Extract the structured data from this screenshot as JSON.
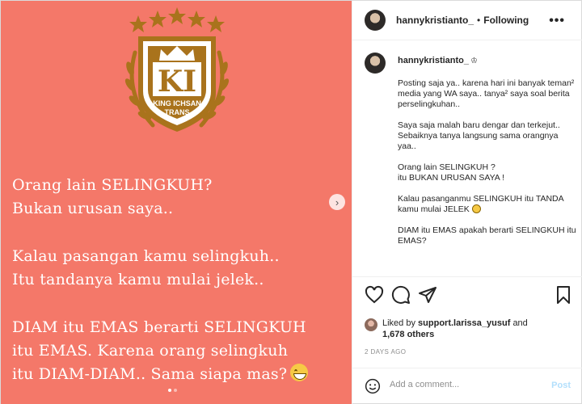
{
  "post": {
    "username": "hannykristianto_",
    "separator": "•",
    "follow_status": "Following",
    "more_icon": "more-icon",
    "colors": {
      "slide_bg": "#f47869",
      "logo_gold": "#a9731c",
      "link": "#0095f6"
    }
  },
  "slide": {
    "logo_text_line1": "KING ICHSAN",
    "logo_text_line2": "TRANS",
    "logo_monogram": "KI",
    "paragraph1": "Orang lain SELINGKUH?\nBukan urusan saya..",
    "paragraph2": "Kalau pasangan kamu selingkuh..\nItu tandanya kamu mulai jelek..",
    "paragraph3_line1": "DIAM itu EMAS berarti SELINGKUH",
    "paragraph3_line2": "itu EMAS. Karena orang selingkuh",
    "paragraph3_line3": "itu DIAM-DIAM.. Sama siapa mas?",
    "next_icon": "›"
  },
  "caption": {
    "username": "hannykristianto_",
    "badge": "♔",
    "text_part1": "Posting saja ya.. karena hari ini banyak teman² media yang WA saya.. tanya² saya soal berita perselingkuhan..\n\nSaya saja malah baru dengar dan terkejut..\nSebaiknya tanya langsung sama orangnya yaa..\n\nOrang lain SELINGKUH ?\nitu BUKAN URUSAN SAYA !\n\nKalau pasanganmu SELINGKUH itu TANDA kamu mulai JELEK ",
    "text_part2": "\n\nDIAM itu EMAS apakah berarti SELINGKUH itu EMAS?"
  },
  "engagement": {
    "liked_prefix": "Liked by",
    "liked_user": "support.larissa_yusuf",
    "liked_and": "and",
    "liked_count": "1,678 others",
    "timestamp": "2 DAYS AGO"
  },
  "comment": {
    "placeholder": "Add a comment...",
    "post_label": "Post"
  }
}
